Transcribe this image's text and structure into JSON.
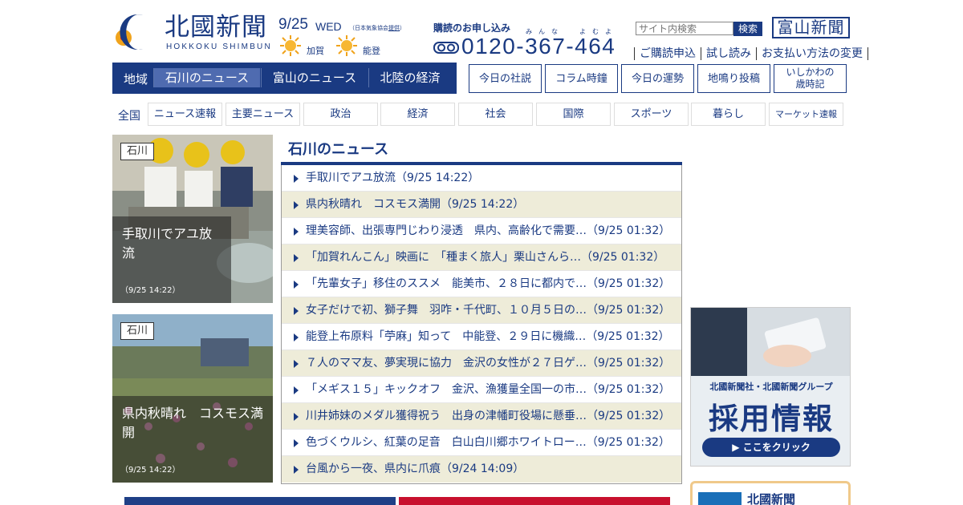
{
  "header": {
    "logo_jp": "北國新聞",
    "logo_en": "HOKKOKU SHIMBUN",
    "date": "9/25",
    "weekday": "WED",
    "weather_note_prefix": "（日本気象協会",
    "weather_note_link": "提供",
    "weather_note_suffix": "）",
    "weather": [
      {
        "area": "加賀",
        "icon": "sun-icon"
      },
      {
        "area": "能登",
        "icon": "sun-icon"
      }
    ],
    "subscribe_title": "購読のお申し込み",
    "ruby_1": "みんな",
    "ruby_2": "よむよ",
    "phone": "0120-367-464",
    "search_placeholder": "サイト内検索",
    "search_button": "検索",
    "toyama_logo": "富山新聞",
    "util_links": [
      "ご購読申込",
      "試し読み",
      "お支払い方法の変更"
    ]
  },
  "region_nav": {
    "label": "地域",
    "tabs": [
      "石川のニュース",
      "富山のニュース",
      "北陸の経済"
    ],
    "active_index": 0
  },
  "box_buttons": [
    "今日の社説",
    "コラム時鐘",
    "今日の運勢",
    "地鳴り投稿",
    "いしかわの\n歳時記"
  ],
  "category_nav": {
    "all": "全国",
    "items": [
      "ニュース速報",
      "主要ニュース",
      "政治",
      "経済",
      "社会",
      "国際",
      "スポーツ",
      "暮らし",
      "マーケット速報"
    ]
  },
  "photo_cards": [
    {
      "tag": "石川",
      "caption": "手取川でアユ放流",
      "time": "（9/25 14:22）"
    },
    {
      "tag": "石川",
      "caption": "県内秋晴れ　コスモス満開",
      "time": "（9/25 14:22）"
    }
  ],
  "news": {
    "title": "石川のニュース",
    "items": [
      "手取川でアユ放流（9/25 14:22）",
      "県内秋晴れ　コスモス満開（9/25 14:22）",
      "理美容師、出張専門じわり浸透　県内、高齢化で需要…（9/25 01:32）",
      "「加賀れんこん」映画に　「種まく旅人」栗山さんら…（9/25 01:32）",
      "「先輩女子」移住のススメ　能美市、２８日に都内で…（9/25 01:32）",
      "女子だけで初、獅子舞　羽咋・千代町、１０月５日の…（9/25 01:32）",
      "能登上布原料「苧麻」知って　中能登、２９日に機織…（9/25 01:32）",
      "７人のママ友、夢実現に協力　金沢の女性が２７日ゲ…（9/25 01:32）",
      "「メギス１５」キックオフ　金沢、漁獲量全国一の市…（9/25 01:32）",
      "川井姉妹のメダル獲得祝う　出身の津幡町役場に懸垂…（9/25 01:32）",
      "色づくウルシ、紅葉の足音　白山白川郷ホワイトロー…（9/25 01:32）",
      "台風から一夜、県内に爪痕（9/24 14:09）"
    ]
  },
  "ad": {
    "line1": "北國新聞社・北國新聞グループ",
    "line2": "採用情報",
    "button": "▶ ここをクリック"
  },
  "ad2": {
    "label": "北國新聞"
  },
  "colors": {
    "brand": "#1a3a82",
    "active_tab": "#4f6bb0",
    "row_alt": "#eeecd9",
    "ad_blue": "#1a6fb8"
  }
}
